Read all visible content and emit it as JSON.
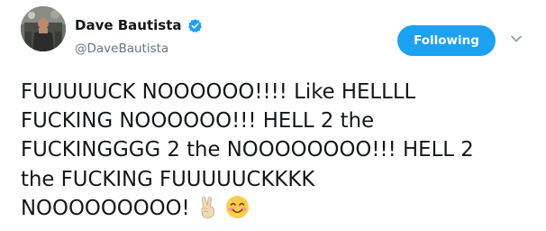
{
  "author": {
    "display_name": "Dave Bautista",
    "handle": "@DaveBautista",
    "verified": true
  },
  "follow_button": {
    "label": "Following"
  },
  "menu": {
    "icon": "chevron-down-icon"
  },
  "tweet": {
    "lines": [
      "FUUUUUCK NOOOOOO!!!! Like HELLLL",
      "FUCKING NOOOOOO!!! HELL 2 the",
      "FUCKINGGGG 2 the NOOOOOOOO!!! HELL 2",
      "the FUCKING FUUUUUCKKKK",
      "NOOOOOOOOO!"
    ],
    "emojis": [
      "victory-hand-emoji",
      "smiling-face-emoji"
    ]
  },
  "colors": {
    "accent": "#1da1f2",
    "text": "#14171a",
    "secondary_text": "#657786",
    "caret": "#8899a6"
  }
}
